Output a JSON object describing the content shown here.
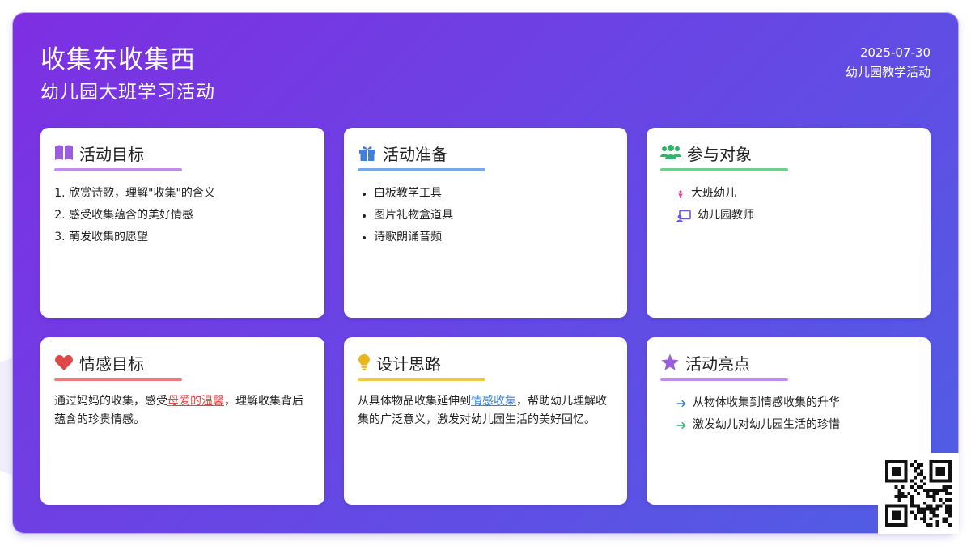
{
  "header": {
    "title": "收集东收集西",
    "subtitle": "幼儿园大班学习活动",
    "date": "2025-07-30",
    "category": "幼儿园教学活动"
  },
  "colors": {
    "gradient_start": "#7e2fe2",
    "gradient_end": "#4f5ee4",
    "goal": "#9b5de0",
    "prep": "#3f7fe0",
    "participants": "#2fb56a",
    "emotion": "#e04848",
    "design": "#e8b720",
    "highlights": "#9b5de0"
  },
  "cards": {
    "goals": {
      "icon": "book-icon",
      "title": "活动目标",
      "items": [
        "欣赏诗歌，理解\"收集\"的含义",
        "感受收集蕴含的美好情感",
        "萌发收集的愿望"
      ]
    },
    "prep": {
      "icon": "gift-icon",
      "title": "活动准备",
      "items": [
        "白板教学工具",
        "图片礼物盒道具",
        "诗歌朗诵音频"
      ]
    },
    "participants": {
      "icon": "users-icon",
      "title": "参与对象",
      "items": [
        {
          "icon": "child-icon",
          "label": "大班幼儿"
        },
        {
          "icon": "teacher-icon",
          "label": "幼儿园教师"
        }
      ]
    },
    "emotion": {
      "icon": "heart-icon",
      "title": "情感目标",
      "text_before": "通过妈妈的收集，感受",
      "highlight": "母爱的温馨",
      "text_after": "，理解收集背后蕴含的珍贵情感。"
    },
    "design": {
      "icon": "lightbulb-icon",
      "title": "设计思路",
      "text_before": "从具体物品收集延伸到",
      "highlight": "情感收集",
      "text_after": "，帮助幼儿理解收集的广泛意义，激发对幼儿园生活的美好回忆。"
    },
    "highlights": {
      "icon": "star-icon",
      "title": "活动亮点",
      "items": [
        "从物体收集到情感收集的升华",
        "激发幼儿对幼儿园生活的珍惜"
      ]
    }
  }
}
